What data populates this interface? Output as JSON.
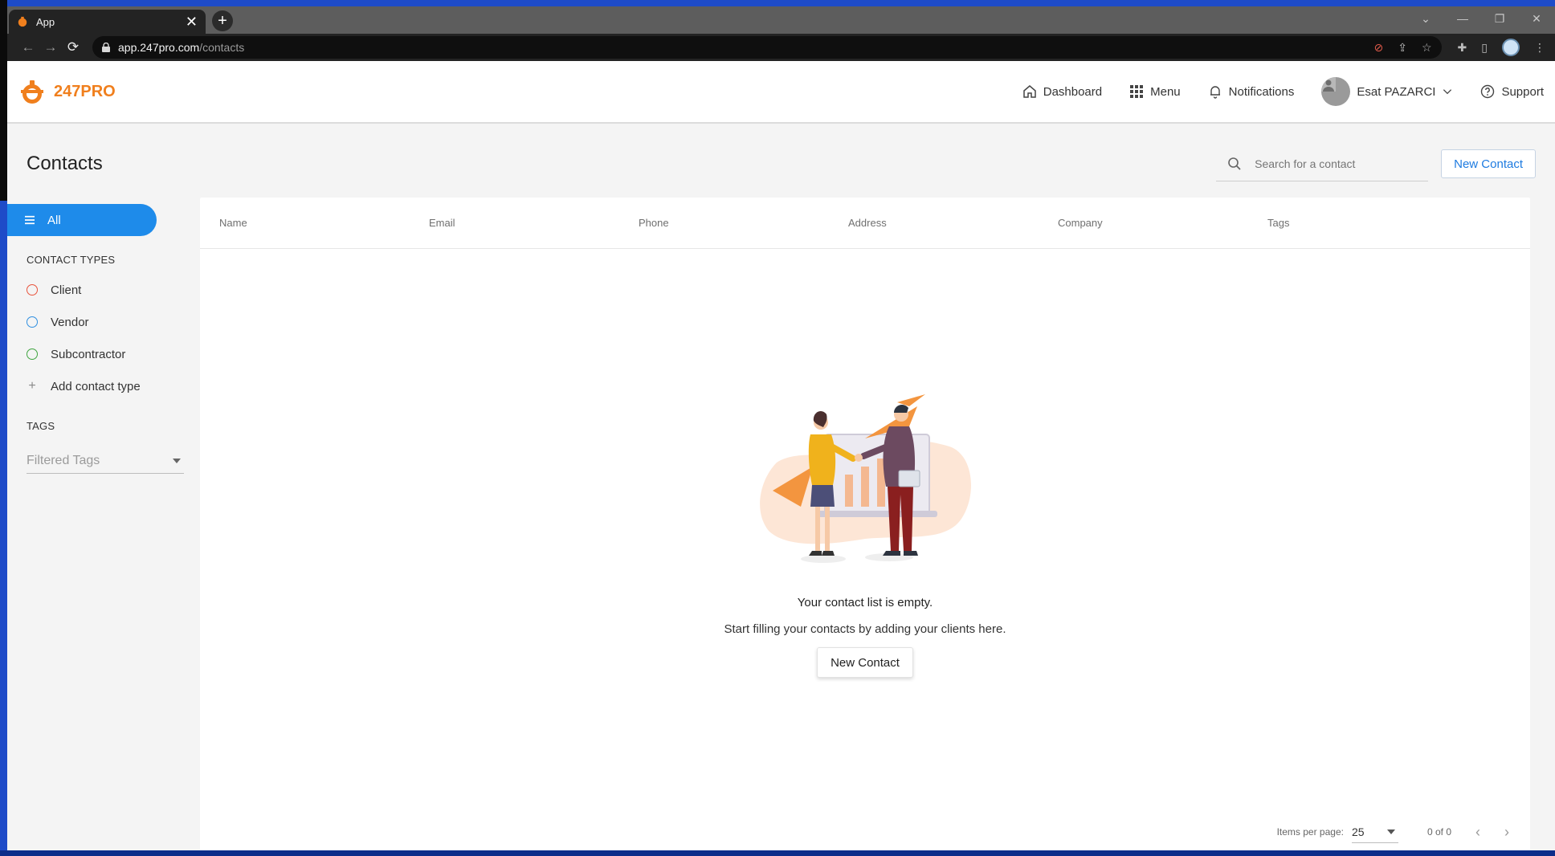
{
  "browser": {
    "tab_title": "App",
    "tab_close": "✕",
    "new_tab": "+",
    "url_host": "app.247pro.com",
    "url_path": "/contacts",
    "window_controls": [
      "⌄",
      "—",
      "❐",
      "✕"
    ]
  },
  "header": {
    "brand": "247PRO",
    "nav": {
      "dashboard": "Dashboard",
      "menu": "Menu",
      "notifications": "Notifications",
      "user": "Esat PAZARCI",
      "support": "Support"
    }
  },
  "page": {
    "title": "Contacts",
    "search_placeholder": "Search for a contact",
    "new_contact": "New Contact"
  },
  "sidebar": {
    "all": "All",
    "contact_types_heading": "CONTACT TYPES",
    "types": [
      {
        "label": "Client",
        "color": "#e8533c"
      },
      {
        "label": "Vendor",
        "color": "#2f8fe0"
      },
      {
        "label": "Subcontractor",
        "color": "#3fa43f"
      }
    ],
    "add_type": "Add contact type",
    "tags_heading": "TAGS",
    "tags_placeholder": "Filtered Tags"
  },
  "table": {
    "columns": [
      "Name",
      "Email",
      "Phone",
      "Address",
      "Company",
      "Tags"
    ]
  },
  "empty_state": {
    "title": "Your contact list is empty.",
    "subtitle": "Start filling your contacts by adding your clients here.",
    "button": "New Contact"
  },
  "paginator": {
    "items_per_page_label": "Items per page:",
    "items_per_page": "25",
    "range": "0 of 0"
  },
  "colors": {
    "brand": "#f07f1d",
    "primary": "#1e8bea"
  }
}
